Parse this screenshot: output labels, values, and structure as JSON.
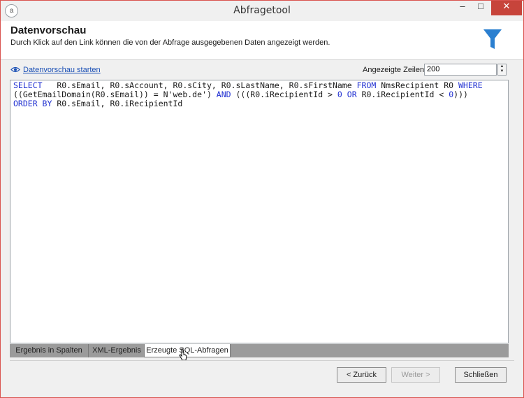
{
  "window": {
    "title": "Abfragetool",
    "minimize": "–",
    "maximize": "□",
    "close": "✕"
  },
  "header": {
    "title": "Datenvorschau",
    "subtitle": "Durch Klick auf den Link können die von der Abfrage ausgegebenen Daten angezeigt werden."
  },
  "toolbar": {
    "preview_link": "Datenvorschau starten",
    "rows_label": "Angezeigte Zeilen:",
    "rows_value": "200"
  },
  "sql": {
    "line1": [
      {
        "t": "SELECT",
        "k": true
      },
      {
        "t": "   R0.sEmail, R0.sAccount, R0.sCity, R0.sLastName, R0.sFirstName ",
        "k": false
      },
      {
        "t": "FROM",
        "k": true
      },
      {
        "t": " NmsRecipient R0 ",
        "k": false
      },
      {
        "t": "WHERE",
        "k": true
      }
    ],
    "line2": [
      {
        "t": "((GetEmailDomain(R0.sEmail)) = N'web.de') ",
        "k": false
      },
      {
        "t": "AND",
        "k": true
      },
      {
        "t": " (((R0.iRecipientId > ",
        "k": false
      },
      {
        "t": "0",
        "k": true
      },
      {
        "t": " ",
        "k": false
      },
      {
        "t": "OR",
        "k": true
      },
      {
        "t": " R0.iRecipientId < ",
        "k": false
      },
      {
        "t": "0",
        "k": true
      },
      {
        "t": ")))",
        "k": false
      }
    ],
    "line3": [
      {
        "t": "ORDER BY",
        "k": true
      },
      {
        "t": " R0.sEmail, R0.iRecipientId",
        "k": false
      }
    ]
  },
  "tabs": [
    "Ergebnis in Spalten",
    "XML-Ergebnis",
    "Erzeugte SQL-Abfragen"
  ],
  "buttons": {
    "back": "< Zurück",
    "next": "Weiter >",
    "close": "Schließen"
  },
  "colors": {
    "keyword": "#1f2fd1",
    "close_button": "#c7443b",
    "link": "#1a4fb5"
  }
}
